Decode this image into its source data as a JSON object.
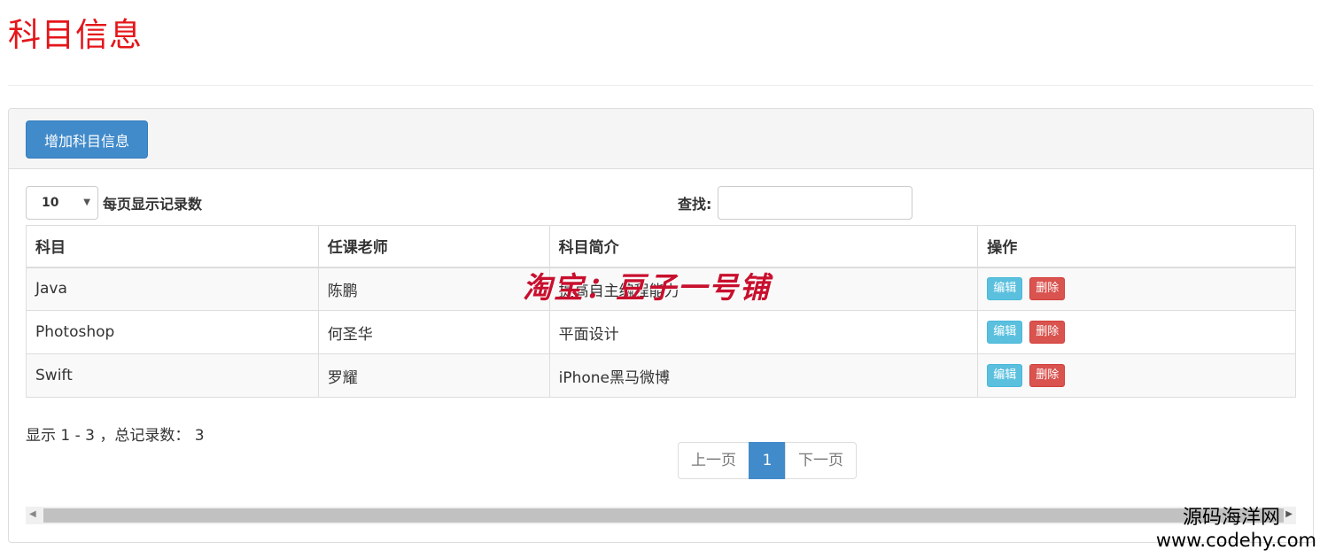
{
  "page": {
    "title": "科目信息"
  },
  "toolbar": {
    "add_label": "增加科目信息"
  },
  "length_menu": {
    "value": "10",
    "label": "每页显示记录数"
  },
  "search": {
    "label": "查找:",
    "value": ""
  },
  "table": {
    "headers": [
      "科目",
      "任课老师",
      "科目简介",
      "操作"
    ],
    "rows": [
      {
        "subject": "Java",
        "teacher": "陈鹏",
        "intro": "提高自主编程能力"
      },
      {
        "subject": "Photoshop",
        "teacher": "何圣华",
        "intro": "平面设计"
      },
      {
        "subject": "Swift",
        "teacher": "罗耀",
        "intro": "iPhone黑马微博"
      }
    ],
    "edit_label": "编辑",
    "delete_label": "删除"
  },
  "info": {
    "text": "显示 1 - 3 ，总记录数： 3"
  },
  "pagination": {
    "prev": "上一页",
    "current": "1",
    "next": "下一页"
  },
  "watermarks": {
    "center": "淘宝：豆子一号铺",
    "site": "源码海洋网",
    "url": "www.codehy.com"
  },
  "colors": {
    "title": "#e4161a",
    "primary": "#428bca",
    "info": "#5bc0de",
    "danger": "#d9534f"
  }
}
